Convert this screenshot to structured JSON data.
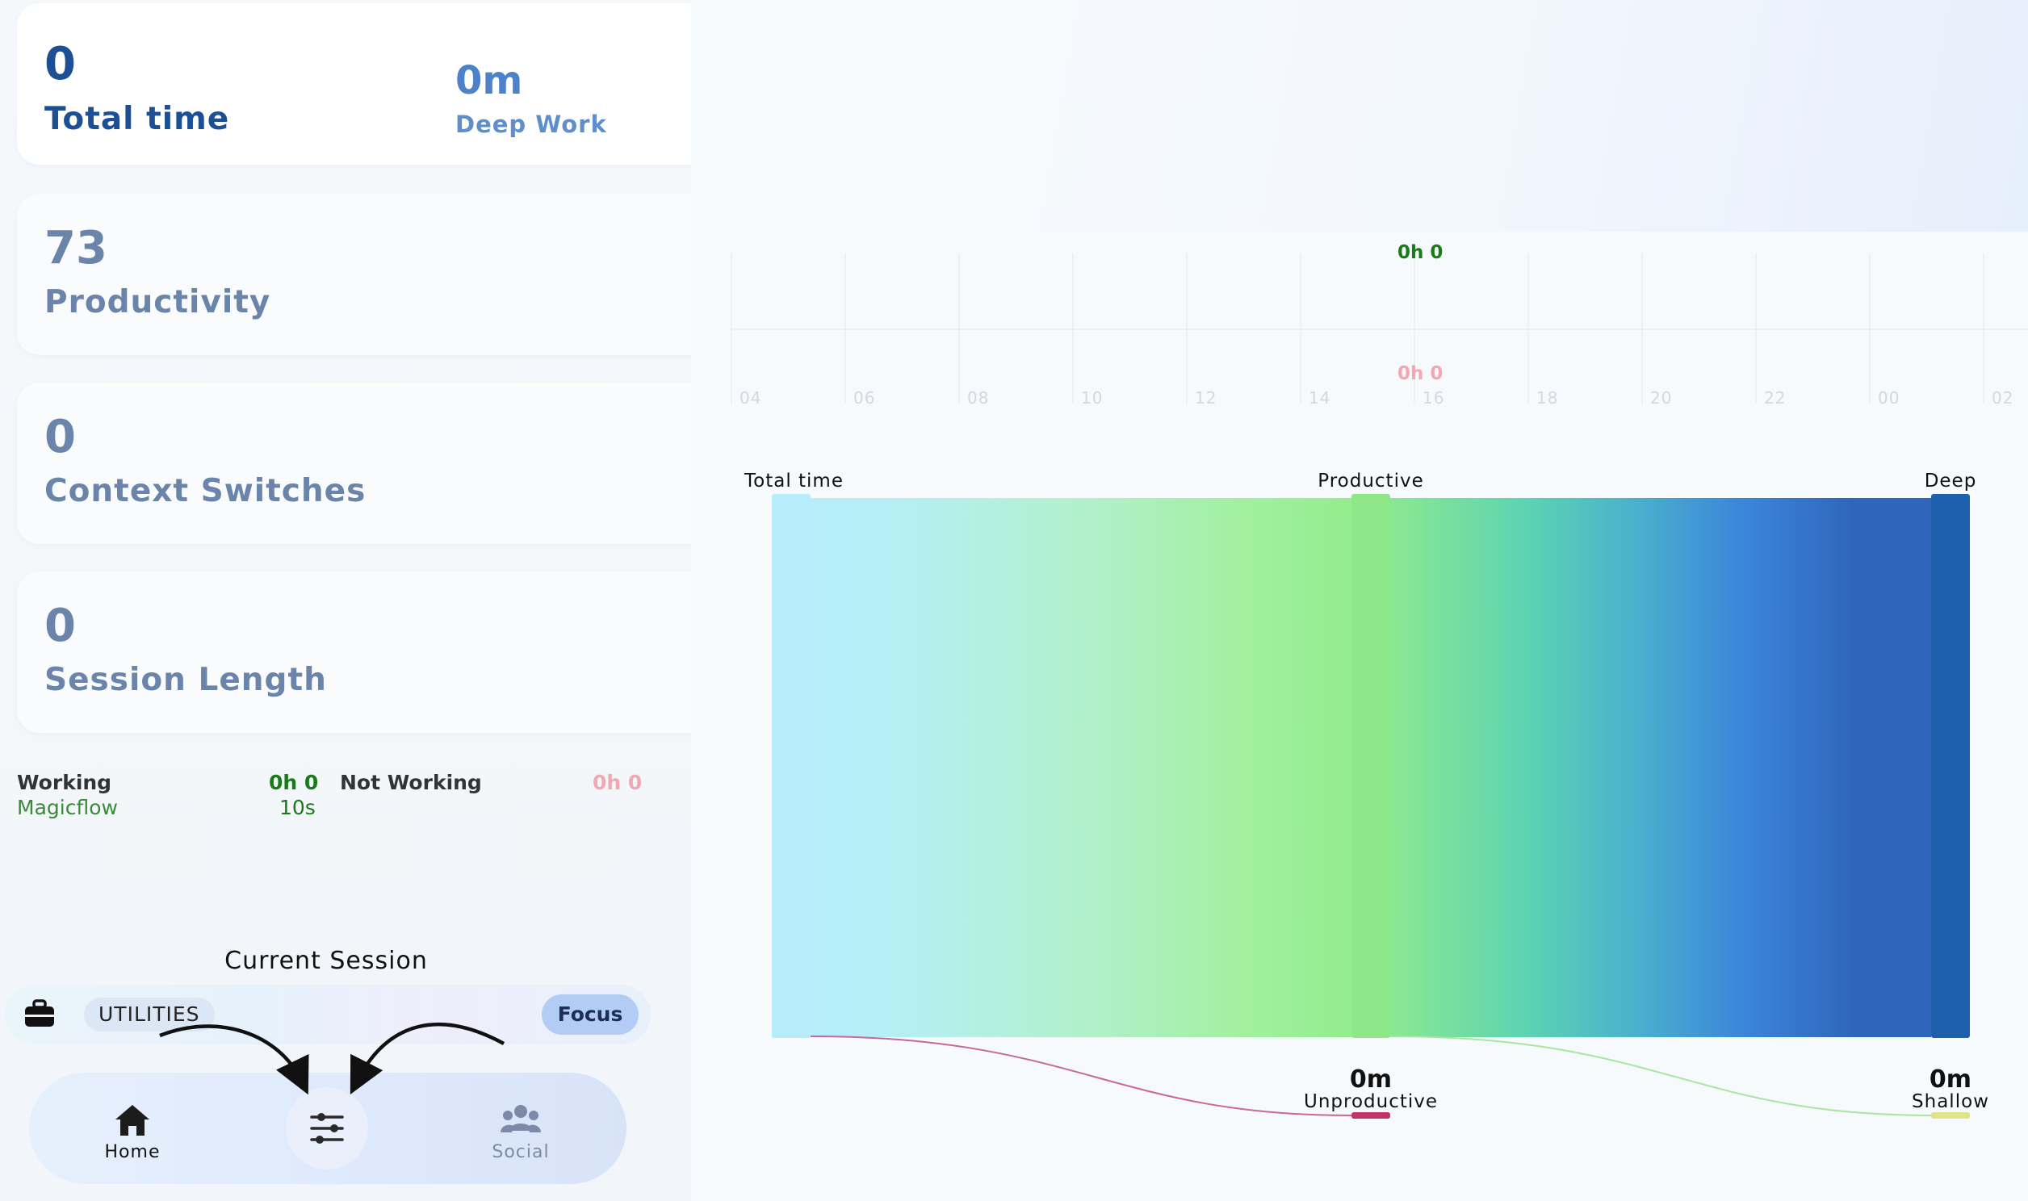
{
  "stats": {
    "total_time": {
      "value": "0",
      "label": "Total time"
    },
    "deep_work": {
      "value": "0m",
      "label": "Deep Work"
    },
    "productivity": {
      "value": "73",
      "label": "Productivity"
    },
    "context_switches": {
      "value": "0",
      "label": "Context Switches"
    },
    "session_length": {
      "value": "0",
      "label": "Session Length"
    }
  },
  "status": {
    "working_label": "Working",
    "working_time": "0h 0",
    "working_app": "Magicflow",
    "working_app_time": "10s",
    "not_working_label": "Not Working",
    "not_working_time": "0h 0"
  },
  "session": {
    "title": "Current Session",
    "category": "UTILITIES",
    "focus_label": "Focus"
  },
  "nav": {
    "home": "Home",
    "social": "Social"
  },
  "timeline": {
    "working_label": "0h 0",
    "not_working_label": "0h 0",
    "ticks": [
      "04",
      "06",
      "08",
      "10",
      "12",
      "14",
      "16",
      "18",
      "20",
      "22",
      "00",
      "02"
    ]
  },
  "sankey": {
    "nodes": {
      "total": "Total time",
      "productive": "Productive",
      "deep": "Deep",
      "unproductive_value": "0m",
      "unproductive_label": "Unproductive",
      "shallow_value": "0m",
      "shallow_label": "Shallow"
    }
  },
  "colors": {
    "primary": "#1d4f94",
    "working": "#1a7a1a",
    "not_working": "#f2a7b3",
    "focus": "#b3ccf6",
    "deep_node": "#1e5fae",
    "productive_node": "#8fe887",
    "total_node": "#b7ecfa",
    "unproductive_node": "#c0336b",
    "shallow_node": "#e0e58a"
  }
}
